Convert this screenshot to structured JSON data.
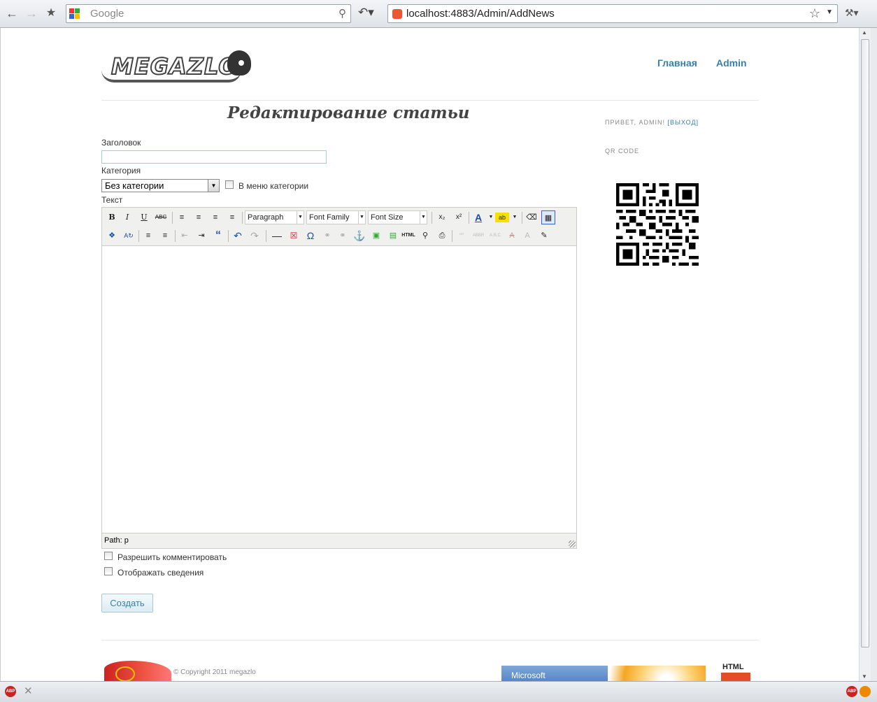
{
  "browser": {
    "search_placeholder": "Google",
    "url": "localhost:4883/Admin/AddNews"
  },
  "header": {
    "logo_text": "MEGAZLO",
    "nav": [
      "Главная",
      "Admin"
    ]
  },
  "main": {
    "title": "Редактирование статьи",
    "labels": {
      "title": "Заголовок",
      "category": "Категория",
      "text": "Текст"
    },
    "category_selected": "Без категории",
    "menu_checkbox_label": "В меню категории",
    "editor": {
      "format_select": "Paragraph",
      "font_family_select": "Font Family",
      "font_size_select": "Font Size",
      "path": "Path: p"
    },
    "allow_comments_label": "Разрешить комментировать",
    "show_info_label": "Отображать сведения",
    "submit_label": "Создать"
  },
  "sidebar": {
    "greeting": "Привет, admin!",
    "logout": "[Выход]",
    "qr_heading": "QR code"
  },
  "footer": {
    "copyright": "© Copyright 2011 megazlo",
    "ms_badge": "Microsoft",
    "html_badge": "HTML"
  },
  "colors": {
    "link": "#3a7fa8",
    "text": "#333333"
  }
}
